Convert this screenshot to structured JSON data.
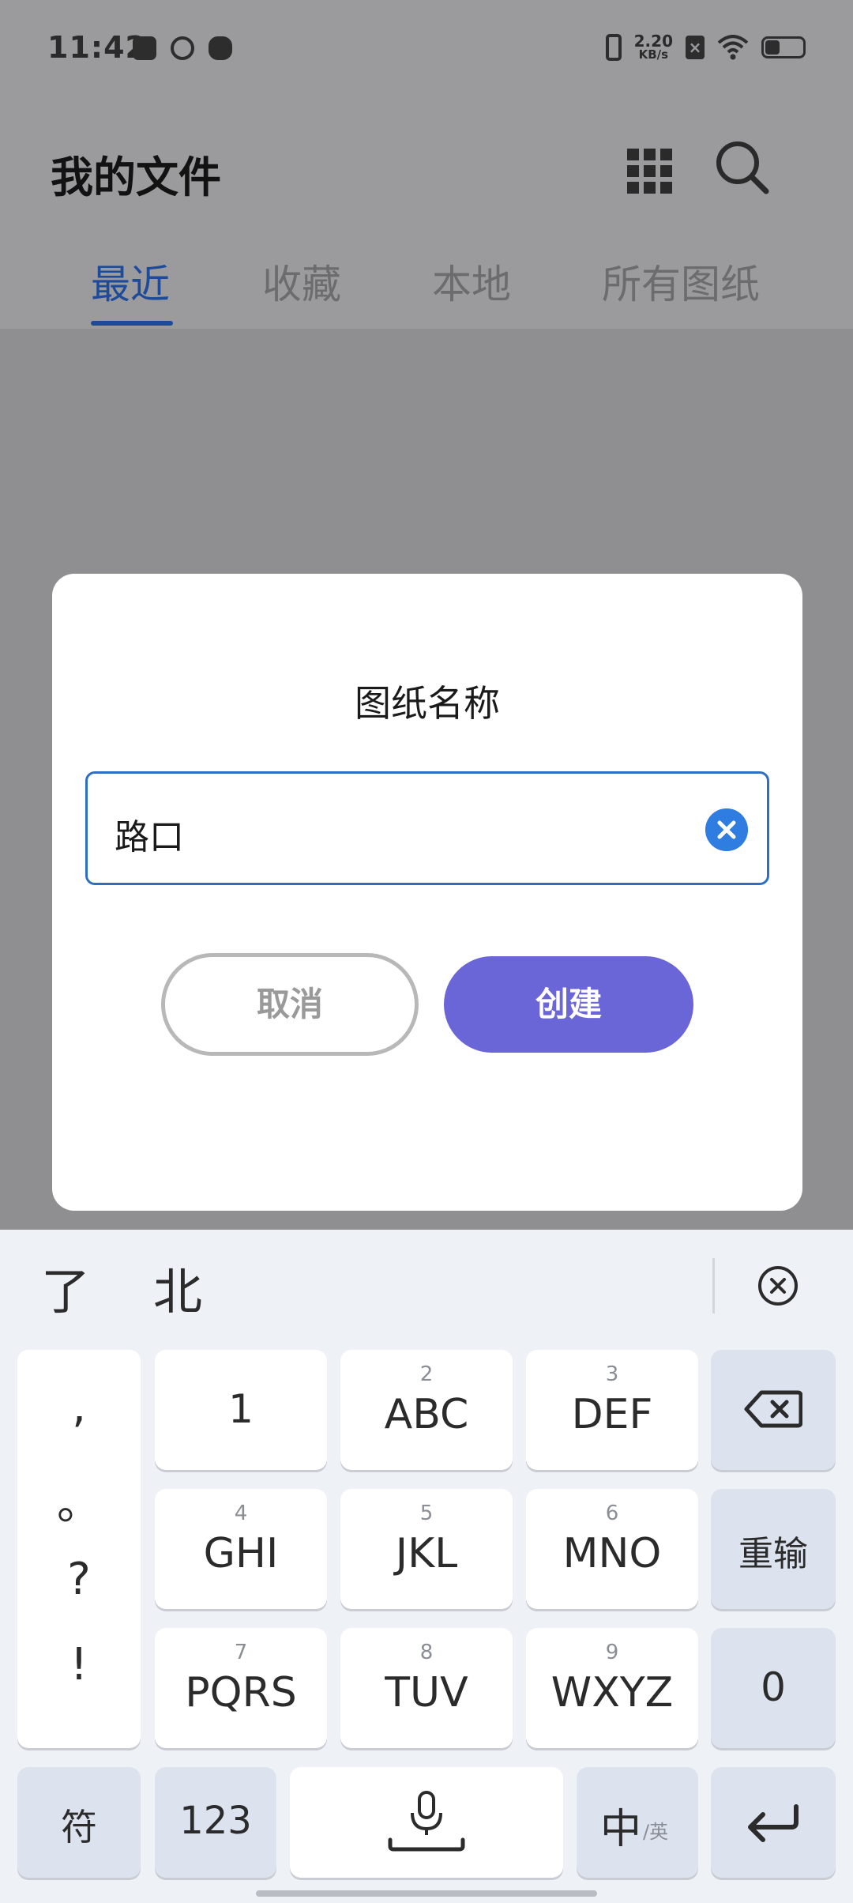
{
  "status_bar": {
    "time": "11:42",
    "net_speed_value": "2.20",
    "net_speed_unit": "KB/s",
    "sim_label": "×"
  },
  "header": {
    "title": "我的文件"
  },
  "tabs": [
    {
      "label": "最近",
      "active": true
    },
    {
      "label": "收藏",
      "active": false
    },
    {
      "label": "本地",
      "active": false
    },
    {
      "label": "所有图纸",
      "active": false
    }
  ],
  "dialog": {
    "title": "图纸名称",
    "input_value": "路口",
    "cancel_label": "取消",
    "create_label": "创建"
  },
  "keyboard": {
    "candidates": [
      "了",
      "北"
    ],
    "punctuation": [
      ",",
      "。",
      "?",
      "!"
    ],
    "keys": {
      "k1": {
        "main": "1",
        "sub": ""
      },
      "k2": {
        "main": "ABC",
        "sub": "2"
      },
      "k3": {
        "main": "DEF",
        "sub": "3"
      },
      "k4": {
        "main": "GHI",
        "sub": "4"
      },
      "k5": {
        "main": "JKL",
        "sub": "5"
      },
      "k6": {
        "main": "MNO",
        "sub": "6"
      },
      "k7": {
        "main": "PQRS",
        "sub": "7"
      },
      "k8": {
        "main": "TUV",
        "sub": "8"
      },
      "k9": {
        "main": "WXYZ",
        "sub": "9"
      }
    },
    "reset_label": "重输",
    "zero_label": "0",
    "symbol_label": "符",
    "numeric_label": "123",
    "lang_main": "中",
    "lang_sub": "/英"
  },
  "colors": {
    "accent_blue": "#1e4a9a",
    "input_border": "#2e6fc4",
    "create_button": "#6a66d8",
    "overlay": "#8f8f91"
  }
}
